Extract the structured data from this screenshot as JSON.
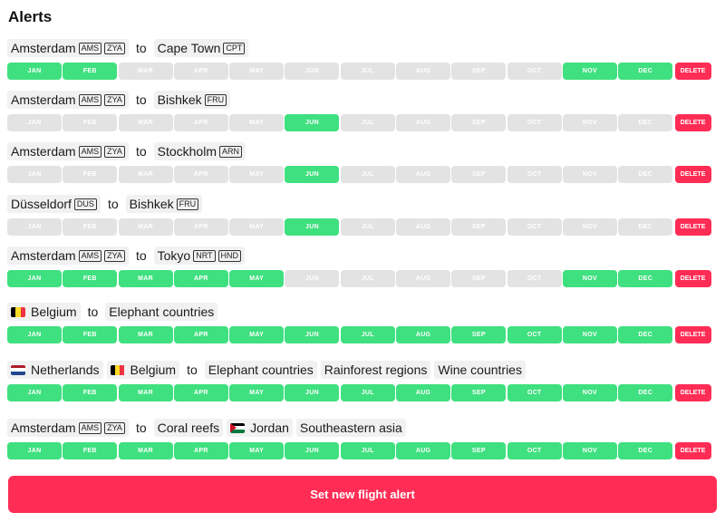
{
  "page_title": "Alerts",
  "months": [
    "JAN",
    "FEB",
    "MAR",
    "APR",
    "MAY",
    "JUN",
    "JUL",
    "AUG",
    "SEP",
    "OCT",
    "NOV",
    "DEC"
  ],
  "delete_label": "DELETE",
  "cta_label": "Set new flight alert",
  "colors": {
    "month_on": "#3fe07f",
    "month_off": "#e3e3e3",
    "accent": "#ff2d55"
  },
  "alerts": [
    {
      "from": [
        {
          "name": "Amsterdam",
          "codes": [
            "AMS",
            "ZYA"
          ]
        }
      ],
      "connector": "to",
      "to": [
        {
          "name": "Cape Town",
          "codes": [
            "CPT"
          ]
        }
      ],
      "months_active": [
        true,
        true,
        false,
        false,
        false,
        false,
        false,
        false,
        false,
        false,
        true,
        true
      ]
    },
    {
      "from": [
        {
          "name": "Amsterdam",
          "codes": [
            "AMS",
            "ZYA"
          ]
        }
      ],
      "connector": "to",
      "to": [
        {
          "name": "Bishkek",
          "codes": [
            "FRU"
          ]
        }
      ],
      "months_active": [
        false,
        false,
        false,
        false,
        false,
        true,
        false,
        false,
        false,
        false,
        false,
        false
      ]
    },
    {
      "from": [
        {
          "name": "Amsterdam",
          "codes": [
            "AMS",
            "ZYA"
          ]
        }
      ],
      "connector": "to",
      "to": [
        {
          "name": "Stockholm",
          "codes": [
            "ARN"
          ]
        }
      ],
      "months_active": [
        false,
        false,
        false,
        false,
        false,
        true,
        false,
        false,
        false,
        false,
        false,
        false
      ]
    },
    {
      "from": [
        {
          "name": "Düsseldorf",
          "codes": [
            "DUS"
          ]
        }
      ],
      "connector": "to",
      "to": [
        {
          "name": "Bishkek",
          "codes": [
            "FRU"
          ]
        }
      ],
      "months_active": [
        false,
        false,
        false,
        false,
        false,
        true,
        false,
        false,
        false,
        false,
        false,
        false
      ]
    },
    {
      "from": [
        {
          "name": "Amsterdam",
          "codes": [
            "AMS",
            "ZYA"
          ]
        }
      ],
      "connector": "to",
      "to": [
        {
          "name": "Tokyo",
          "codes": [
            "NRT",
            "HND"
          ]
        }
      ],
      "months_active": [
        true,
        true,
        true,
        true,
        true,
        false,
        false,
        false,
        false,
        false,
        true,
        true
      ]
    },
    {
      "from": [
        {
          "name": "Belgium",
          "codes": [],
          "flag": "belgium"
        }
      ],
      "connector": "to",
      "to": [
        {
          "name": "Elephant countries",
          "codes": []
        }
      ],
      "months_active": [
        true,
        true,
        true,
        true,
        true,
        true,
        true,
        true,
        true,
        true,
        true,
        true
      ]
    },
    {
      "from": [
        {
          "name": "Netherlands",
          "codes": [],
          "flag": "netherlands"
        },
        {
          "name": "Belgium",
          "codes": [],
          "flag": "belgium"
        }
      ],
      "connector": "to",
      "to": [
        {
          "name": "Elephant countries",
          "codes": []
        },
        {
          "name": "Rainforest regions",
          "codes": []
        },
        {
          "name": "Wine countries",
          "codes": []
        }
      ],
      "months_active": [
        true,
        true,
        true,
        true,
        true,
        true,
        true,
        true,
        true,
        true,
        true,
        true
      ]
    },
    {
      "from": [
        {
          "name": "Amsterdam",
          "codes": [
            "AMS",
            "ZYA"
          ]
        }
      ],
      "connector": "to",
      "to": [
        {
          "name": "Coral reefs",
          "codes": []
        },
        {
          "name": "Jordan",
          "codes": [],
          "flag": "jordan"
        },
        {
          "name": "Southeastern asia",
          "codes": []
        }
      ],
      "months_active": [
        true,
        true,
        true,
        true,
        true,
        true,
        true,
        true,
        true,
        true,
        true,
        true
      ]
    }
  ]
}
